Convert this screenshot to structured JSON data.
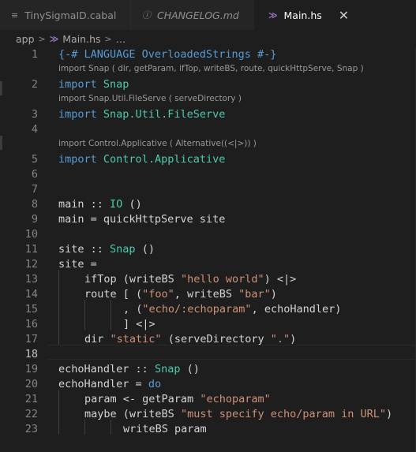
{
  "tabs": [
    {
      "icon": "≡",
      "label": "TinySigmaID.cabal"
    },
    {
      "icon": "ⓘ",
      "label": "CHANGELOG.md"
    },
    {
      "icon": "≫",
      "label": "Main.hs",
      "close": "✕"
    }
  ],
  "breadcrumb": {
    "folder": "app",
    "file": "Main.hs",
    "more": "…"
  },
  "lines": [
    {
      "n": "1",
      "lens": "import Snap ( dir, getParam, ifTop, writeBS, route, quickHttpServe, Snap )"
    },
    {
      "n": "2",
      "lens": "import Snap.Util.FileServe ( serveDirectory )"
    },
    {
      "n": "3",
      "lens": ""
    },
    {
      "n": "4",
      "lens": "import Control.Applicative ( Alternative((<|>)) )"
    },
    {
      "n": "5",
      "lens": ""
    },
    {
      "n": "6",
      "lens": ""
    },
    {
      "n": "7",
      "lens": ""
    },
    {
      "n": "8",
      "lens": ""
    },
    {
      "n": "9",
      "lens": ""
    },
    {
      "n": "10",
      "lens": ""
    },
    {
      "n": "11",
      "lens": ""
    },
    {
      "n": "12",
      "lens": ""
    },
    {
      "n": "13",
      "lens": ""
    },
    {
      "n": "14",
      "lens": ""
    },
    {
      "n": "15",
      "lens": ""
    },
    {
      "n": "16",
      "lens": ""
    },
    {
      "n": "17",
      "lens": ""
    },
    {
      "n": "18",
      "lens": ""
    },
    {
      "n": "19",
      "lens": ""
    },
    {
      "n": "20",
      "lens": ""
    },
    {
      "n": "21",
      "lens": ""
    },
    {
      "n": "22",
      "lens": ""
    },
    {
      "n": "23",
      "lens": ""
    }
  ],
  "code": {
    "l1": "{-# LANGUAGE OverloadedStrings #-}",
    "l2a": "import",
    "l2b": "Snap",
    "l3a": "import",
    "l3b": "Snap.Util.FileServe",
    "l5a": "import",
    "l5b": "Control.Applicative",
    "l8a": "main ::",
    "l8b": "IO",
    "l8c": "()",
    "l9": "main = quickHttpServe site",
    "l11a": "site ::",
    "l11b": "Snap",
    "l11c": "()",
    "l12": "site =",
    "l13a": "ifTop (writeBS",
    "l13b": "\"hello world\"",
    "l13c": ") <|>",
    "l14a": "route [ (",
    "l14b": "\"foo\"",
    "l14c": ", writeBS",
    "l14d": "\"bar\"",
    "l14e": ")",
    "l15a": ", (",
    "l15b": "\"echo/:echoparam\"",
    "l15c": ", echoHandler)",
    "l16": "] <|>",
    "l17a": "dir",
    "l17b": "\"static\"",
    "l17c": "(serveDirectory",
    "l17d": "\".\"",
    "l17e": ")",
    "l19a": "echoHandler ::",
    "l19b": "Snap",
    "l19c": "()",
    "l20a": "echoHandler =",
    "l20b": "do",
    "l21a": "param <- getParam",
    "l21b": "\"echoparam\"",
    "l22a": "maybe (writeBS",
    "l22b": "\"must specify echo/param in URL\"",
    "l22c": ")",
    "l23": "writeBS param"
  },
  "colors": {
    "keyword": "#569cd6",
    "type": "#4ec9b0",
    "string": "#ce9178",
    "background": "#1e1e1e"
  }
}
